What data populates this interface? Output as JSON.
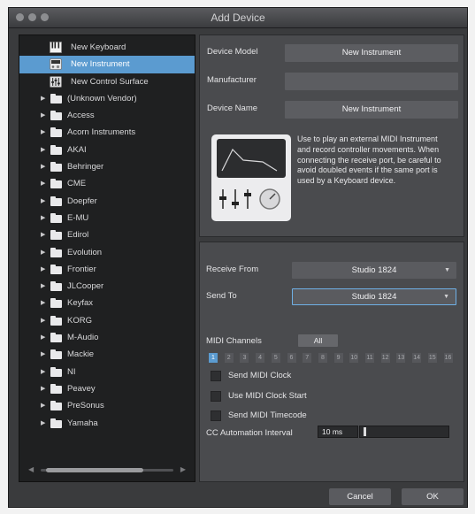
{
  "window": {
    "title": "Add Device"
  },
  "tree": {
    "devices": [
      {
        "label": "New Keyboard",
        "icon": "keyboard-icon"
      },
      {
        "label": "New Instrument",
        "icon": "instrument-icon",
        "selected": true
      },
      {
        "label": "New Control Surface",
        "icon": "control-surface-icon"
      }
    ],
    "folders": [
      "(Unknown Vendor)",
      "Access",
      "Acorn Instruments",
      "AKAI",
      "Behringer",
      "CME",
      "Doepfer",
      "E-MU",
      "Edirol",
      "Evolution",
      "Frontier",
      "JLCooper",
      "Keyfax",
      "KORG",
      "M-Audio",
      "Mackie",
      "NI",
      "Peavey",
      "PreSonus",
      "Yamaha"
    ]
  },
  "device": {
    "model_label": "Device Model",
    "model_value": "New Instrument",
    "manufacturer_label": "Manufacturer",
    "manufacturer_value": "",
    "name_label": "Device Name",
    "name_value": "New Instrument",
    "description": "Use to play an external MIDI Instrument and record controller movements. When connecting the receive port, be careful to avoid doubled events if the same port is used by a Keyboard device."
  },
  "routing": {
    "receive_label": "Receive From",
    "receive_value": "Studio 1824",
    "send_label": "Send To",
    "send_value": "Studio 1824",
    "channels_label": "MIDI Channels",
    "all_label": "All",
    "channels": [
      "1",
      "2",
      "3",
      "4",
      "5",
      "6",
      "7",
      "8",
      "9",
      "10",
      "11",
      "12",
      "13",
      "14",
      "15",
      "16"
    ],
    "active_channel": "1",
    "send_clock_label": "Send MIDI Clock",
    "clock_start_label": "Use MIDI Clock Start",
    "timecode_label": "Send MIDI Timecode",
    "cc_label": "CC Automation Interval",
    "cc_value": "10 ms"
  },
  "buttons": {
    "cancel": "Cancel",
    "ok": "OK"
  }
}
